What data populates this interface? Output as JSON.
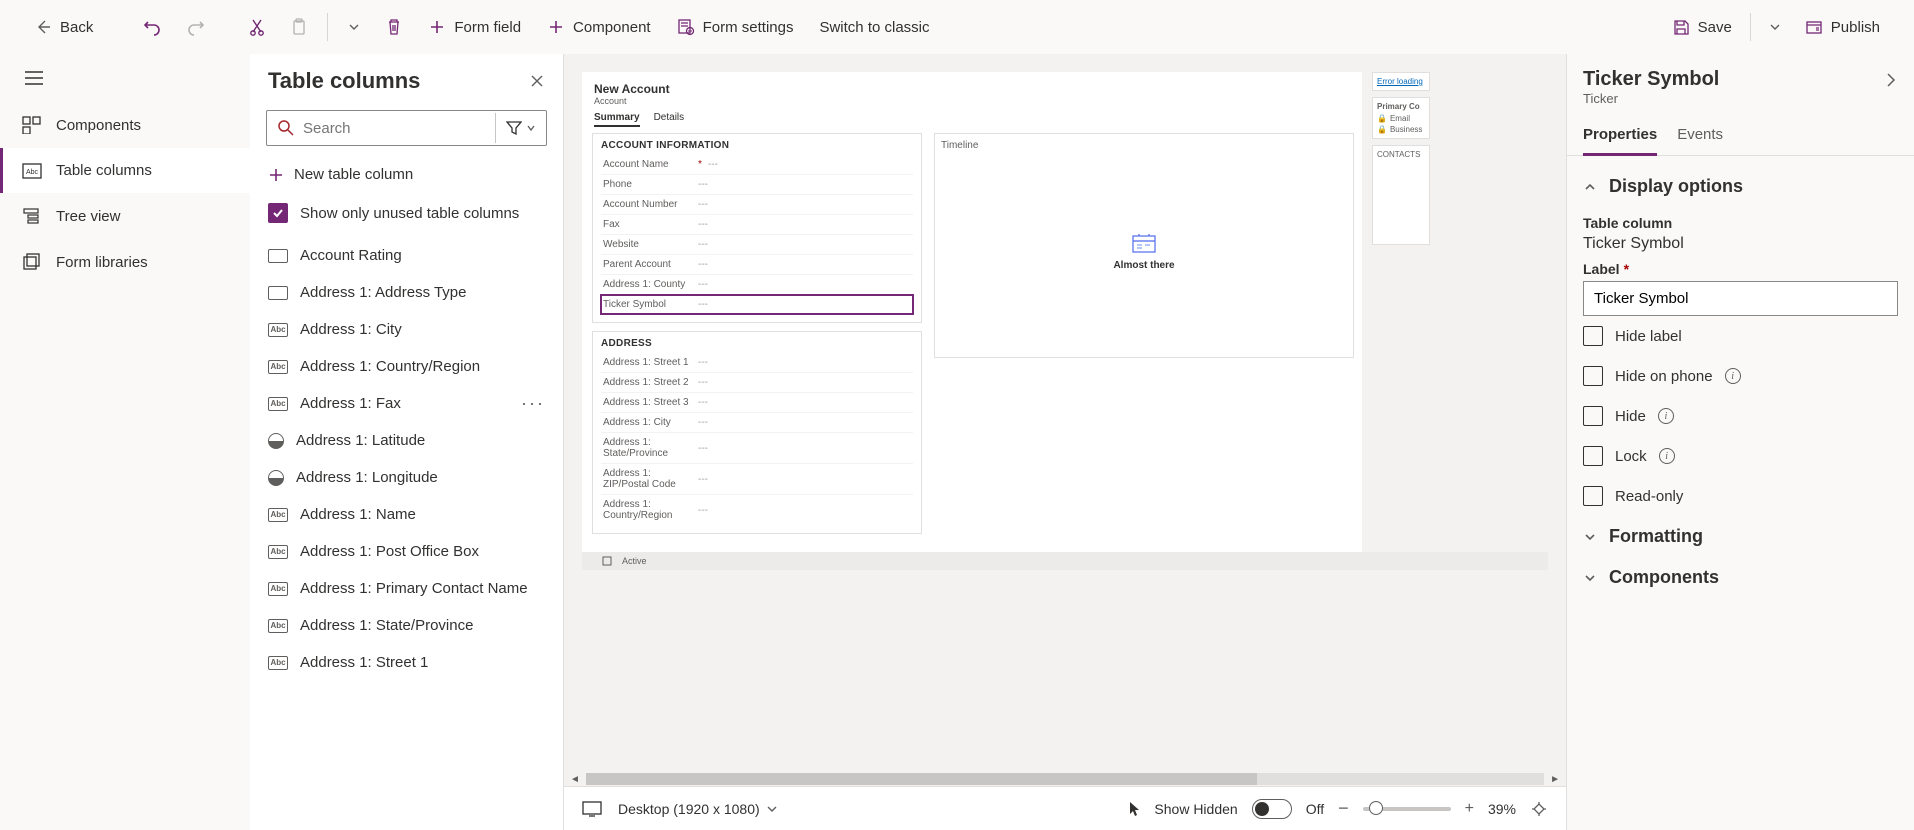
{
  "toolbar": {
    "back": "Back",
    "form_field": "Form field",
    "component": "Component",
    "form_settings": "Form settings",
    "switch_classic": "Switch to classic",
    "save": "Save",
    "publish": "Publish"
  },
  "nav": {
    "components": "Components",
    "table_columns": "Table columns",
    "tree_view": "Tree view",
    "form_libraries": "Form libraries"
  },
  "colpanel": {
    "title": "Table columns",
    "search_placeholder": "Search",
    "new_column": "New table column",
    "show_only": "Show only unused table columns",
    "columns": [
      {
        "label": "Account Rating",
        "type": "opt"
      },
      {
        "label": "Address 1: Address Type",
        "type": "opt"
      },
      {
        "label": "Address 1: City",
        "type": "abc"
      },
      {
        "label": "Address 1: Country/Region",
        "type": "abc"
      },
      {
        "label": "Address 1: Fax",
        "type": "abc",
        "more": true
      },
      {
        "label": "Address 1: Latitude",
        "type": "round"
      },
      {
        "label": "Address 1: Longitude",
        "type": "round"
      },
      {
        "label": "Address 1: Name",
        "type": "abc"
      },
      {
        "label": "Address 1: Post Office Box",
        "type": "abc"
      },
      {
        "label": "Address 1: Primary Contact Name",
        "type": "abc"
      },
      {
        "label": "Address 1: State/Province",
        "type": "abc"
      },
      {
        "label": "Address 1: Street 1",
        "type": "abc"
      }
    ]
  },
  "form": {
    "title": "New Account",
    "subtitle": "Account",
    "tabs": [
      "Summary",
      "Details"
    ],
    "section1": {
      "title": "ACCOUNT INFORMATION",
      "rows": [
        {
          "label": "Account Name",
          "required": true,
          "val": "---"
        },
        {
          "label": "Phone",
          "val": "---"
        },
        {
          "label": "Account Number",
          "val": "---"
        },
        {
          "label": "Fax",
          "val": "---"
        },
        {
          "label": "Website",
          "val": "---"
        },
        {
          "label": "Parent Account",
          "val": "---"
        },
        {
          "label": "Address 1: County",
          "val": "---"
        },
        {
          "label": "Ticker Symbol",
          "val": "---",
          "selected": true
        }
      ]
    },
    "section2": {
      "title": "ADDRESS",
      "rows": [
        {
          "label": "Address 1: Street 1",
          "val": "---"
        },
        {
          "label": "Address 1: Street 2",
          "val": "---"
        },
        {
          "label": "Address 1: Street 3",
          "val": "---"
        },
        {
          "label": "Address 1: City",
          "val": "---"
        },
        {
          "label": "Address 1: State/Province",
          "val": "---"
        },
        {
          "label": "Address 1: ZIP/Postal Code",
          "val": "---"
        },
        {
          "label": "Address 1: Country/Region",
          "val": "---"
        }
      ]
    },
    "timeline": {
      "title": "Timeline",
      "msg": "Almost there"
    },
    "stubs": {
      "error": "Error loading",
      "primary": "Primary Co",
      "email": "Email",
      "business": "Business",
      "contacts": "CONTACTS"
    },
    "status": "Active"
  },
  "footer": {
    "viewport": "Desktop (1920 x 1080)",
    "show_hidden": "Show Hidden",
    "toggle_label": "Off",
    "zoom": "39%"
  },
  "props": {
    "title": "Ticker Symbol",
    "subtitle": "Ticker",
    "tabs": {
      "properties": "Properties",
      "events": "Events"
    },
    "display_options": "Display options",
    "table_column_label": "Table column",
    "table_column_value": "Ticker Symbol",
    "label_label": "Label",
    "label_value": "Ticker Symbol",
    "hide_label": "Hide label",
    "hide_on_phone": "Hide on phone",
    "hide": "Hide",
    "lock": "Lock",
    "read_only": "Read-only",
    "formatting": "Formatting",
    "components": "Components"
  }
}
